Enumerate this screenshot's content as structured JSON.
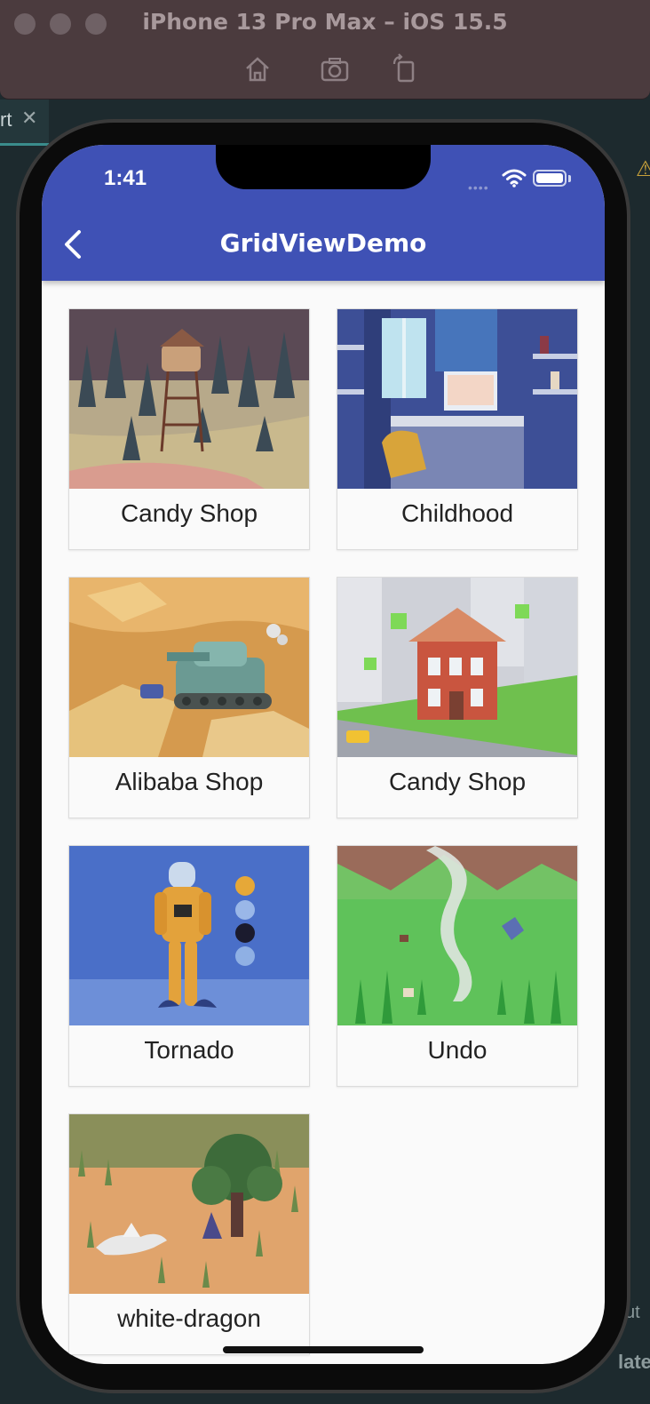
{
  "simulator": {
    "title": "iPhone 13 Pro Max – iOS 15.5",
    "tools": [
      "home-icon",
      "screenshot-icon",
      "rotate-icon"
    ]
  },
  "ide": {
    "tab_fragment": "rt",
    "tab_close": "✕",
    "right_fragment_1": "ut",
    "right_fragment_2": "later",
    "warning_glyph": "⚠"
  },
  "status_bar": {
    "time": "1:41",
    "signal": "••••"
  },
  "app_bar": {
    "title": "GridViewDemo",
    "color": "#3f51b5"
  },
  "grid": {
    "items": [
      {
        "label": "Candy Shop"
      },
      {
        "label": "Childhood"
      },
      {
        "label": "Alibaba Shop"
      },
      {
        "label": "Candy Shop"
      },
      {
        "label": "Tornado"
      },
      {
        "label": "Undo"
      },
      {
        "label": "white-dragon"
      }
    ]
  }
}
